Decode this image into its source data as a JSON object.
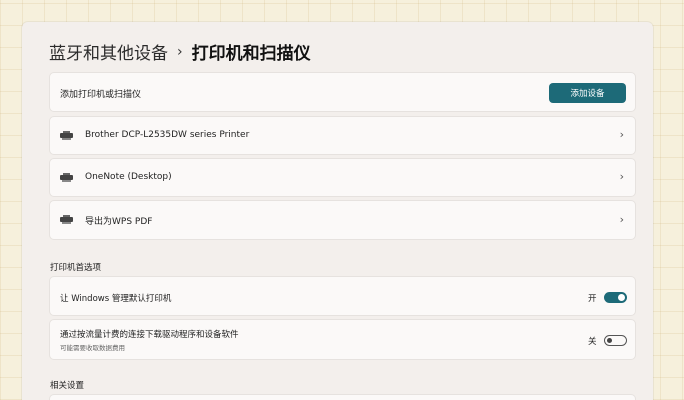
{
  "breadcrumb": {
    "parent": "蓝牙和其他设备",
    "separator": "›",
    "current": "打印机和扫描仪"
  },
  "add_device": {
    "label": "添加打印机或扫描仪",
    "button": "添加设备"
  },
  "printers": [
    {
      "name": "Brother DCP-L2535DW series Printer",
      "icon": "printer-icon"
    },
    {
      "name": "OneNote (Desktop)",
      "icon": "printer-icon"
    },
    {
      "name": "导出为WPS PDF",
      "icon": "printer-icon"
    }
  ],
  "chevron": "›",
  "preferences": {
    "title": "打印机首选项",
    "manage_default": {
      "label": "让 Windows 管理默认打印机",
      "state_text": "开",
      "on": true
    },
    "metered": {
      "label": "通过按流量计费的连接下载驱动程序和设备软件",
      "sublabel": "可能需要收取数据费用",
      "state_text": "关",
      "on": false
    }
  },
  "related": {
    "title": "相关设置"
  },
  "colors": {
    "accent": "#1d6a78"
  }
}
